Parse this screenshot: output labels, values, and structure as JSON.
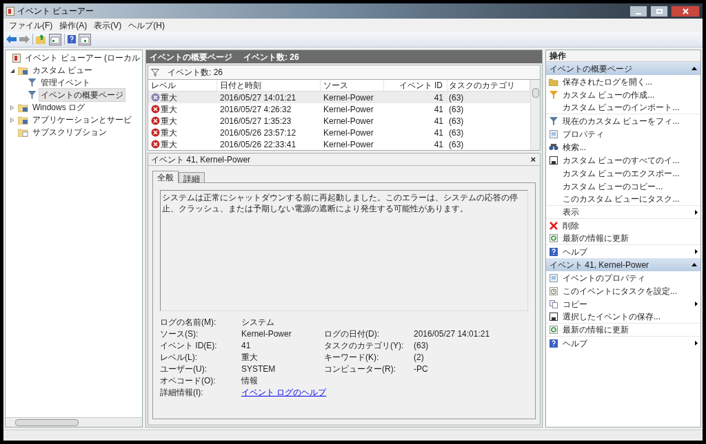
{
  "window": {
    "title": "イベント ビューアー"
  },
  "menu": [
    "ファイル(F)",
    "操作(A)",
    "表示(V)",
    "ヘルプ(H)"
  ],
  "tree": [
    {
      "label": "イベント ビューアー (ローカル",
      "kind": "root",
      "selected": false,
      "children": [
        {
          "label": "カスタム ビュー",
          "kind": "folder",
          "selected": false,
          "expanded": true,
          "children": [
            {
              "label": "管理イベント",
              "kind": "filter",
              "selected": false
            },
            {
              "label": "イベントの概要ページ",
              "kind": "filter",
              "selected": true
            }
          ]
        },
        {
          "label": "Windows ログ",
          "kind": "folder",
          "selected": false,
          "expanded": false
        },
        {
          "label": "アプリケーションとサービ",
          "kind": "folder",
          "selected": false,
          "expanded": false
        },
        {
          "label": "サブスクリプション",
          "kind": "subscription",
          "selected": false
        }
      ]
    }
  ],
  "summary": {
    "title": "イベントの概要ページ",
    "count": "イベント数: 26",
    "filter_label": "イベント数: 26"
  },
  "table": {
    "columns": [
      "レベル",
      "日付と時刻",
      "ソース",
      "イベント ID",
      "タスクのカテゴリ"
    ],
    "rows": [
      {
        "level": "重大",
        "date": "2016/05/27 14:01:21",
        "source": "Kernel-Power",
        "id": "41",
        "category": "(63)",
        "selected": true
      },
      {
        "level": "重大",
        "date": "2016/05/27 4:26:32",
        "source": "Kernel-Power",
        "id": "41",
        "category": "(63)",
        "selected": false
      },
      {
        "level": "重大",
        "date": "2016/05/27 1:35:23",
        "source": "Kernel-Power",
        "id": "41",
        "category": "(63)",
        "selected": false
      },
      {
        "level": "重大",
        "date": "2016/05/26 23:57:12",
        "source": "Kernel-Power",
        "id": "41",
        "category": "(63)",
        "selected": false
      },
      {
        "level": "重大",
        "date": "2016/05/26 22:33:41",
        "source": "Kernel-Power",
        "id": "41",
        "category": "(63)",
        "selected": false
      }
    ]
  },
  "detail": {
    "title": "イベント 41, Kernel-Power",
    "close": "×",
    "tabs": [
      {
        "label": "全般",
        "selected": true
      },
      {
        "label": "詳細",
        "selected": false
      }
    ],
    "message": "システムは正常にシャットダウンする前に再起動しました。このエラーは、システムの応答の停止、クラッシュ、または予期しない電源の遮断により発生する可能性があります。",
    "fields": [
      {
        "label": "ログの名前(M):",
        "value": "システム",
        "kind": "text"
      },
      {
        "label": "ソース(S):",
        "value": "Kernel-Power",
        "kind": "text",
        "right_label": "ログの日付(D):",
        "right_value": "2016/05/27 14:01:21"
      },
      {
        "label": "イベント ID(E):",
        "value": "41",
        "kind": "text",
        "right_label": "タスクのカテゴリ(Y):",
        "right_value": "(63)"
      },
      {
        "label": "レベル(L):",
        "value": "重大",
        "kind": "text",
        "right_label": "キーワード(K):",
        "right_value": "(2)"
      },
      {
        "label": "ユーザー(U):",
        "value": "SYSTEM",
        "kind": "text",
        "right_label": "コンピューター(R):",
        "right_value": "-PC"
      },
      {
        "label": "オペコード(O):",
        "value": "情報",
        "kind": "text"
      },
      {
        "label": "詳細情報(I):",
        "value": "イベント ログのヘルプ",
        "kind": "link"
      }
    ]
  },
  "actions": {
    "title": "操作",
    "sections": [
      {
        "title": "イベントの概要ページ",
        "expanded": true,
        "items": [
          {
            "label": "保存されたログを開く...",
            "kind": "open",
            "submenu": false,
            "separator_after": false
          },
          {
            "label": "カスタム ビューの作成...",
            "kind": "filter",
            "submenu": false,
            "separator_after": false
          },
          {
            "label": "カスタム ビューのインポート...",
            "kind": "none",
            "submenu": false,
            "separator_after": true
          },
          {
            "label": "現在のカスタム ビューをフィ...",
            "kind": "filter2",
            "submenu": false,
            "separator_after": false
          },
          {
            "label": "プロパティ",
            "kind": "properties",
            "submenu": false,
            "separator_after": false
          },
          {
            "label": "検索...",
            "kind": "find",
            "submenu": false,
            "separator_after": false
          },
          {
            "label": "カスタム ビューのすべてのイ...",
            "kind": "save",
            "submenu": false,
            "separator_after": false
          },
          {
            "label": "カスタム ビューのエクスポー...",
            "kind": "none",
            "submenu": false,
            "separator_after": false
          },
          {
            "label": "カスタム ビューのコピー...",
            "kind": "none",
            "submenu": false,
            "separator_after": false
          },
          {
            "label": "このカスタム ビューにタスク...",
            "kind": "none",
            "submenu": false,
            "separator_after": true
          },
          {
            "label": "表示",
            "kind": "none",
            "submenu": true,
            "separator_after": true
          },
          {
            "label": "削除",
            "kind": "delete",
            "submenu": false,
            "separator_after": false
          },
          {
            "label": "最新の情報に更新",
            "kind": "refresh",
            "submenu": false,
            "separator_after": true
          },
          {
            "label": "ヘルプ",
            "kind": "help",
            "submenu": true,
            "separator_after": false
          }
        ]
      },
      {
        "title": "イベント 41, Kernel-Power",
        "expanded": true,
        "items": [
          {
            "label": "イベントのプロパティ",
            "kind": "properties",
            "submenu": false,
            "separator_after": false
          },
          {
            "label": "このイベントにタスクを設定...",
            "kind": "task",
            "submenu": false,
            "separator_after": false
          },
          {
            "label": "コピー",
            "kind": "copy",
            "submenu": true,
            "separator_after": false
          },
          {
            "label": "選択したイベントの保存...",
            "kind": "save",
            "submenu": false,
            "separator_after": true
          },
          {
            "label": "最新の情報に更新",
            "kind": "refresh",
            "submenu": false,
            "separator_after": true
          },
          {
            "label": "ヘルプ",
            "kind": "help",
            "submenu": true,
            "separator_after": false
          }
        ]
      }
    ]
  }
}
